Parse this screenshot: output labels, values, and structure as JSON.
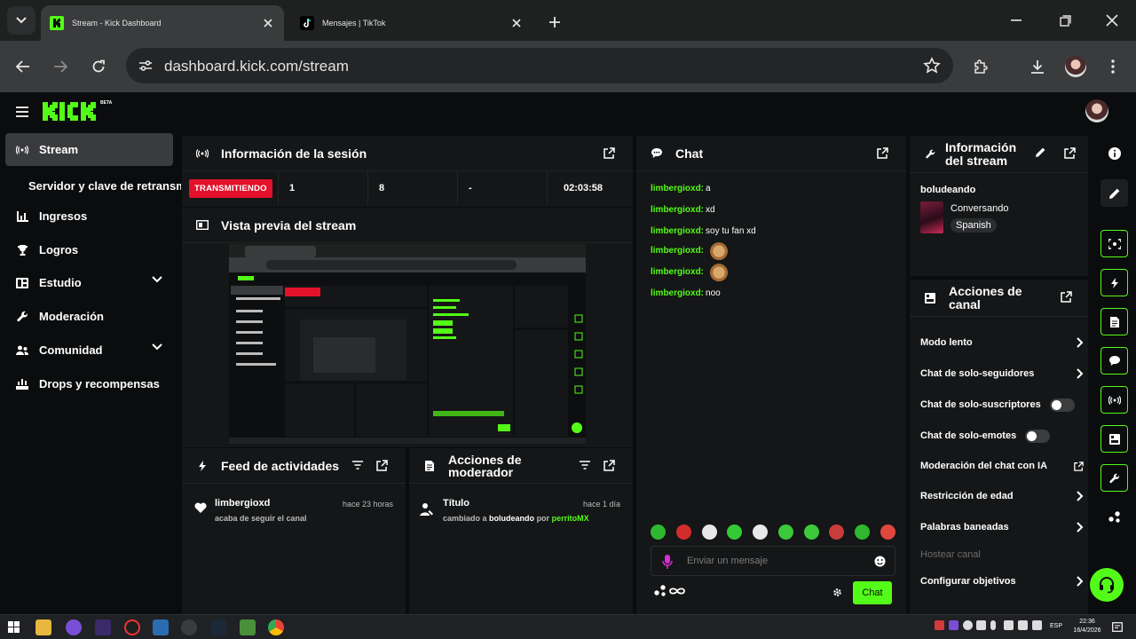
{
  "browser": {
    "tabs": [
      {
        "title": "Stream - Kick Dashboard",
        "active": true,
        "favicon": "kick-logo-icon"
      },
      {
        "title": "Mensajes | TikTok",
        "active": false,
        "favicon": "tiktok-logo-icon"
      }
    ],
    "url": "dashboard.kick.com/stream"
  },
  "app": {
    "logo_badge": "BETA",
    "accent_color": "#53fc18",
    "live_color": "#e3112c"
  },
  "sidebar": {
    "items": [
      {
        "label": "Stream",
        "icon": "broadcast-icon",
        "active": true
      },
      {
        "label": "Servidor y clave de retransmisión",
        "sub": true
      },
      {
        "label": "Ingresos",
        "icon": "chart-icon"
      },
      {
        "label": "Logros",
        "icon": "trophy-icon"
      },
      {
        "label": "Estudio",
        "icon": "studio-icon",
        "expandable": true
      },
      {
        "label": "Moderación",
        "icon": "wrench-icon"
      },
      {
        "label": "Comunidad",
        "icon": "users-icon",
        "expandable": true
      },
      {
        "label": "Drops y recompensas",
        "icon": "drops-icon"
      }
    ]
  },
  "session": {
    "title": "Información de la sesión",
    "status": "TRANSMITIENDO",
    "stat1": "1",
    "stat2": "8",
    "stat3": "-",
    "duration": "02:03:58"
  },
  "preview": {
    "title": "Vista previa del stream"
  },
  "feed": {
    "title": "Feed de actividades",
    "items": [
      {
        "user": "limbergioxd",
        "desc": "acaba de seguir el canal",
        "time": "hace 23 horas"
      }
    ]
  },
  "mod_actions": {
    "title": "Acciones de moderador",
    "items": [
      {
        "title": "Título",
        "desc_prefix": "cambiado a",
        "value": "boludeando",
        "by": "por",
        "user": "perritoMX",
        "time": "hace 1 día"
      }
    ]
  },
  "chat": {
    "title": "Chat",
    "messages": [
      {
        "user": "limbergioxd:",
        "text": "a"
      },
      {
        "user": "limbergioxd:",
        "text": "xd"
      },
      {
        "user": "limbergioxd:",
        "text": "soy tu fan xd"
      },
      {
        "user": "limbergioxd:",
        "text": "",
        "emote": "cat-emote"
      },
      {
        "user": "limbergioxd:",
        "text": "",
        "emote": "cat-emote"
      },
      {
        "user": "limbergioxd:",
        "text": "noo"
      }
    ],
    "placeholder": "Enviar un mensaje",
    "send_label": "Chat"
  },
  "stream_info": {
    "title": "Información del stream",
    "stream_title": "boludeando",
    "category": "Conversando",
    "language": "Spanish"
  },
  "channel_actions": {
    "title": "Acciones de canal",
    "items": [
      {
        "label": "Modo lento",
        "control": "chevron"
      },
      {
        "label": "Chat de solo-seguidores",
        "control": "chevron"
      },
      {
        "label": "Chat de solo-suscriptores",
        "control": "toggle"
      },
      {
        "label": "Chat de solo-emotes",
        "control": "toggle"
      },
      {
        "label": "Moderación del chat con IA",
        "control": "external"
      },
      {
        "label": "Restricción de edad",
        "control": "chevron"
      },
      {
        "label": "Palabras baneadas",
        "control": "chevron"
      },
      {
        "label": "Hostear canal",
        "control": "none",
        "disabled": true
      },
      {
        "label": "Configurar objetivos",
        "control": "chevron"
      }
    ]
  },
  "taskbar": {
    "lang": "ESP",
    "time": "22:36",
    "date": "16/4/2026"
  }
}
